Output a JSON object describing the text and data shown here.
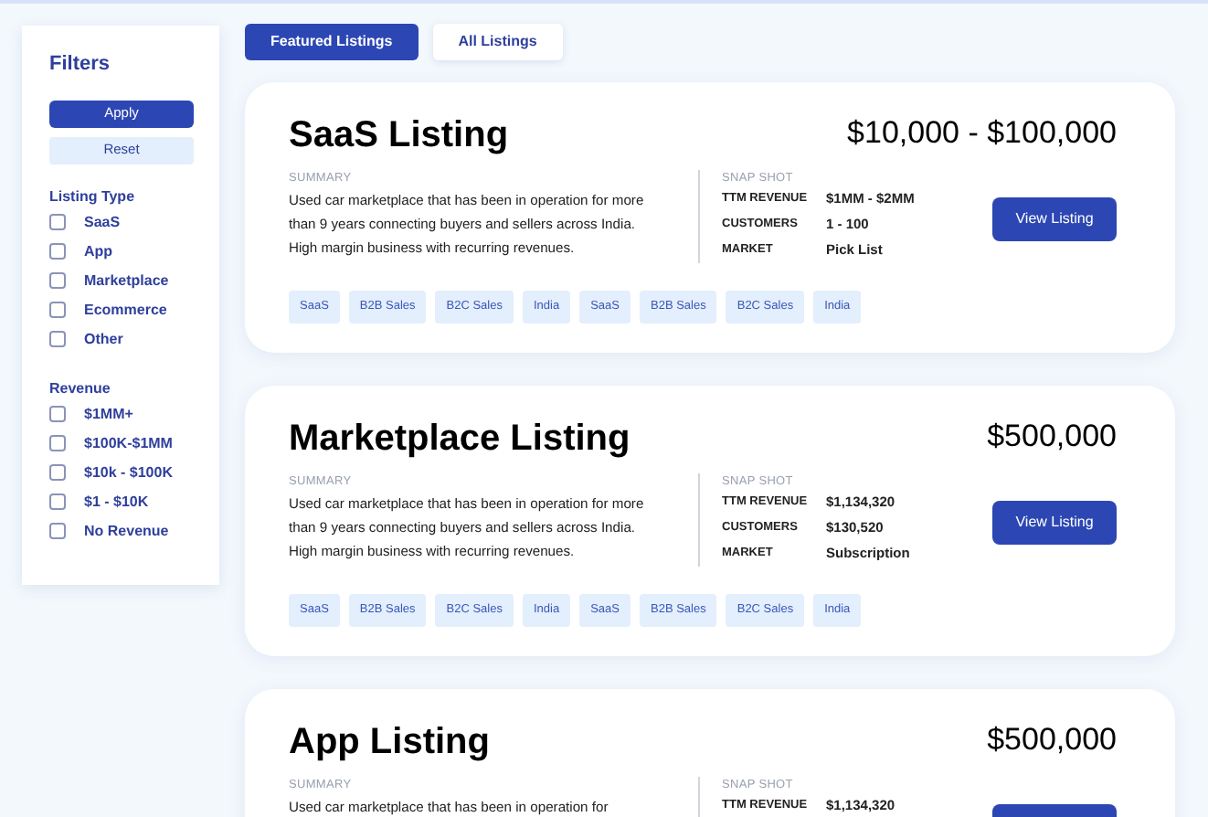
{
  "filters": {
    "title": "Filters",
    "apply": "Apply",
    "reset": "Reset",
    "groups": [
      {
        "title": "Listing Type",
        "options": [
          {
            "label": "SaaS",
            "checked": false
          },
          {
            "label": "App",
            "checked": false
          },
          {
            "label": "Marketplace",
            "checked": false
          },
          {
            "label": "Ecommerce",
            "checked": false
          },
          {
            "label": "Other",
            "checked": false
          }
        ]
      },
      {
        "title": "Revenue",
        "options": [
          {
            "label": "$1MM+",
            "checked": false
          },
          {
            "label": "$100K-$1MM",
            "checked": false
          },
          {
            "label": "$10k - $100K",
            "checked": false
          },
          {
            "label": "$1 - $10K",
            "checked": false
          },
          {
            "label": "No Revenue",
            "checked": false
          }
        ]
      }
    ]
  },
  "tabs": [
    {
      "label": "Featured Listings",
      "selected": true
    },
    {
      "label": "All Listings",
      "selected": false
    }
  ],
  "listings": [
    {
      "title": "SaaS Listing",
      "price": "$10,000 - $100,000",
      "summary_label": "SUMMARY",
      "summary": "Used car marketplace that has been in operation for more than 9 years connecting buyers and sellers across India. High margin business with recurring revenues.",
      "snapshot_label": "SNAP SHOT",
      "stats": [
        {
          "label": "TTM REVENUE",
          "value": "$1MM - $2MM"
        },
        {
          "label": "CUSTOMERS",
          "value": "1 - 100"
        },
        {
          "label": "MARKET",
          "value": "Pick List"
        }
      ],
      "button": "View Listing",
      "tags": [
        "SaaS",
        "B2B Sales",
        "B2C Sales",
        "India",
        "SaaS",
        "B2B Sales",
        "B2C Sales",
        "India"
      ]
    },
    {
      "title": "Marketplace Listing",
      "price": "$500,000",
      "summary_label": "SUMMARY",
      "summary": "Used car marketplace that has been in operation for more than 9 years connecting buyers and sellers across India. High margin business with recurring revenues.",
      "snapshot_label": "SNAP SHOT",
      "stats": [
        {
          "label": "TTM REVENUE",
          "value": "$1,134,320"
        },
        {
          "label": "CUSTOMERS",
          "value": "$130,520"
        },
        {
          "label": "MARKET",
          "value": "Subscription"
        }
      ],
      "button": "View Listing",
      "tags": [
        "SaaS",
        "B2B Sales",
        "B2C Sales",
        "India",
        "SaaS",
        "B2B Sales",
        "B2C Sales",
        "India"
      ]
    },
    {
      "title": "App Listing",
      "price": "$500,000",
      "summary_label": "SUMMARY",
      "summary": "Used car marketplace that has been in operation for",
      "snapshot_label": "SNAP SHOT",
      "stats": [
        {
          "label": "TTM REVENUE",
          "value": "$1,134,320"
        }
      ],
      "has_button": true
    }
  ]
}
